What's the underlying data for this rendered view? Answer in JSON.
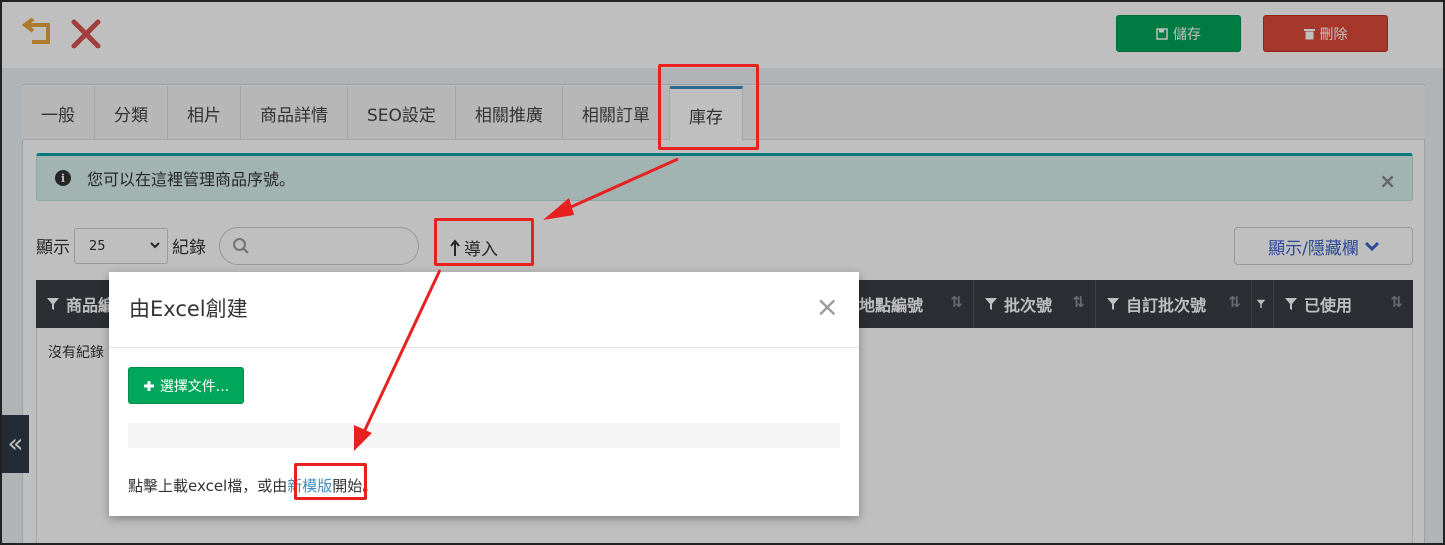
{
  "toolbar": {
    "back_icon": "undo-icon",
    "close_icon": "close-icon",
    "save_label": "儲存",
    "delete_label": "刪除",
    "save_color": "#00a65a",
    "delete_color": "#dd4b39"
  },
  "tabs": [
    {
      "label": "一般"
    },
    {
      "label": "分類"
    },
    {
      "label": "相片"
    },
    {
      "label": "商品詳情"
    },
    {
      "label": "SEO設定"
    },
    {
      "label": "相關推廣"
    },
    {
      "label": "相關訂單"
    },
    {
      "label": "庫存",
      "active": true
    }
  ],
  "alert": {
    "text": "您可以在這裡管理商品序號。",
    "close": "×"
  },
  "table_controls": {
    "show_label": "顯示",
    "page_length": "25",
    "records_label": "紀錄",
    "search_placeholder": "",
    "import_label": "導入",
    "colvis_label": "顯示/隱藏欄"
  },
  "table": {
    "columns": [
      {
        "label": "商品編"
      },
      {
        "label": "地點編號"
      },
      {
        "label": "批次號"
      },
      {
        "label": "自訂批次號"
      },
      {
        "label": ""
      },
      {
        "label": "已使用"
      }
    ],
    "empty_text": "沒有紀錄"
  },
  "sidebar_toggle": "«",
  "modal": {
    "title": "由Excel創建",
    "close": "×",
    "choose_file_label": "選擇文件...",
    "progress": 0,
    "text_before": "點擊上載excel檔，或由",
    "link_text": "新模版",
    "text_after": "開始。"
  }
}
